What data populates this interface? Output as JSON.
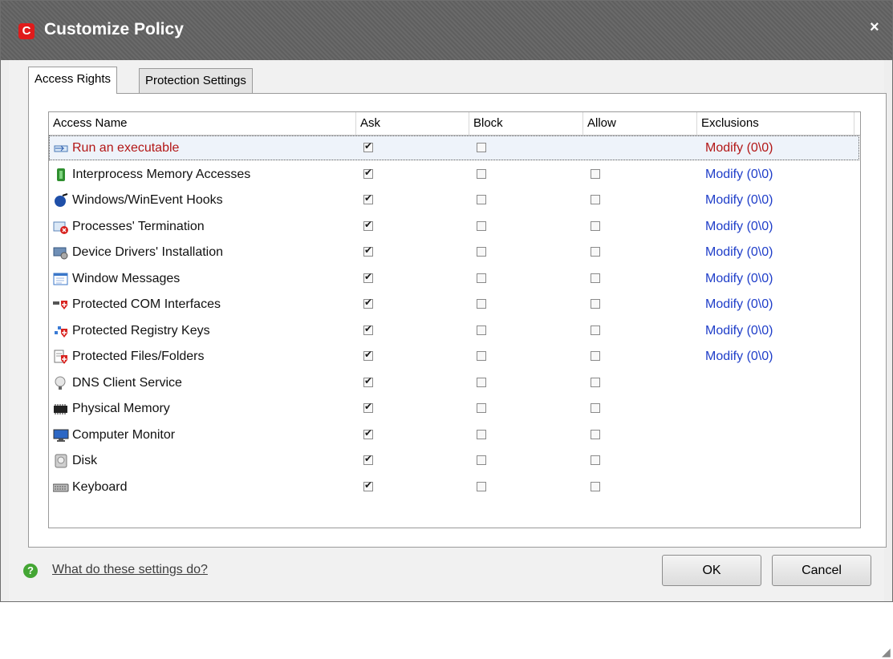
{
  "window": {
    "title": "Customize Policy",
    "close_glyph": "×"
  },
  "tabs": [
    {
      "label": "Access Rights"
    },
    {
      "label": "Protection Settings"
    }
  ],
  "columns": [
    "Access Name",
    "Ask",
    "Block",
    "Allow",
    "Exclusions"
  ],
  "rows": [
    {
      "name": "Run an executable",
      "icon": "run-executable-icon",
      "ask": true,
      "block": false,
      "allow": null,
      "exclusions": "Modify (0\\0)",
      "selected": true
    },
    {
      "name": "Interprocess Memory Accesses",
      "icon": "memory-access-icon",
      "ask": true,
      "block": false,
      "allow": false,
      "exclusions": "Modify (0\\0)"
    },
    {
      "name": "Windows/WinEvent Hooks",
      "icon": "hook-icon",
      "ask": true,
      "block": false,
      "allow": false,
      "exclusions": "Modify (0\\0)"
    },
    {
      "name": "Processes' Termination",
      "icon": "process-termination-icon",
      "ask": true,
      "block": false,
      "allow": false,
      "exclusions": "Modify (0\\0)"
    },
    {
      "name": "Device Drivers' Installation",
      "icon": "device-driver-icon",
      "ask": true,
      "block": false,
      "allow": false,
      "exclusions": "Modify (0\\0)"
    },
    {
      "name": "Window Messages",
      "icon": "window-messages-icon",
      "ask": true,
      "block": false,
      "allow": false,
      "exclusions": "Modify (0\\0)"
    },
    {
      "name": "Protected COM Interfaces",
      "icon": "com-interfaces-icon",
      "ask": true,
      "block": false,
      "allow": false,
      "exclusions": "Modify (0\\0)"
    },
    {
      "name": "Protected Registry Keys",
      "icon": "registry-keys-icon",
      "ask": true,
      "block": false,
      "allow": false,
      "exclusions": "Modify (0\\0)"
    },
    {
      "name": "Protected Files/Folders",
      "icon": "files-folders-icon",
      "ask": true,
      "block": false,
      "allow": false,
      "exclusions": "Modify (0\\0)"
    },
    {
      "name": "DNS Client Service",
      "icon": "dns-client-icon",
      "ask": true,
      "block": false,
      "allow": false,
      "exclusions": ""
    },
    {
      "name": "Physical Memory",
      "icon": "physical-memory-icon",
      "ask": true,
      "block": false,
      "allow": false,
      "exclusions": ""
    },
    {
      "name": "Computer Monitor",
      "icon": "monitor-icon",
      "ask": true,
      "block": false,
      "allow": false,
      "exclusions": ""
    },
    {
      "name": "Disk",
      "icon": "disk-icon",
      "ask": true,
      "block": false,
      "allow": false,
      "exclusions": ""
    },
    {
      "name": "Keyboard",
      "icon": "keyboard-icon",
      "ask": true,
      "block": false,
      "allow": false,
      "exclusions": ""
    }
  ],
  "footer": {
    "help_text": "What do these settings do?",
    "help_glyph": "?",
    "ok": "OK",
    "cancel": "Cancel"
  },
  "colors": {
    "link": "#1f3ec9",
    "selected_text": "#b31717",
    "accent": "#e01b1b"
  }
}
